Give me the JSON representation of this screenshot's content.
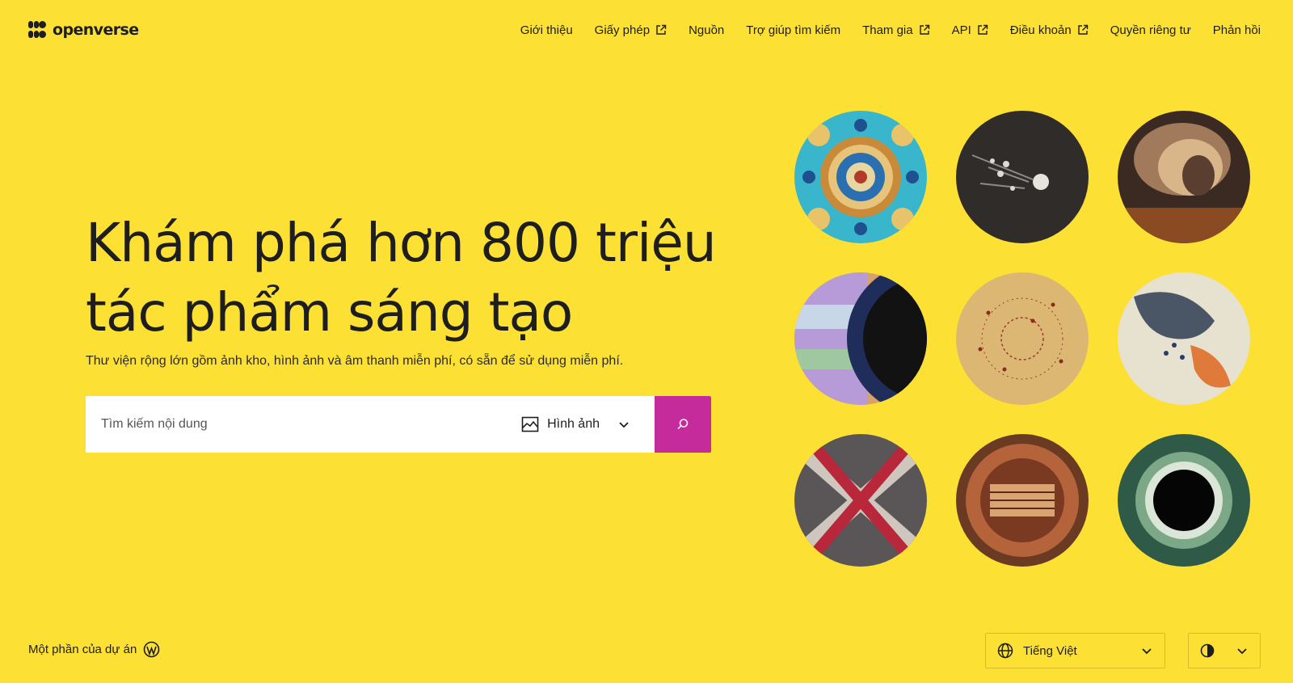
{
  "brand": {
    "name": "openverse"
  },
  "nav": {
    "items": [
      {
        "label": "Giới thiệu",
        "external": false
      },
      {
        "label": "Giấy phép",
        "external": true
      },
      {
        "label": "Nguồn",
        "external": false
      },
      {
        "label": "Trợ giúp tìm kiếm",
        "external": false
      },
      {
        "label": "Tham gia",
        "external": true
      },
      {
        "label": "API",
        "external": true
      },
      {
        "label": "Điều khoản",
        "external": true
      },
      {
        "label": "Quyền riêng tư",
        "external": false
      },
      {
        "label": "Phản hồi",
        "external": false
      }
    ]
  },
  "hero": {
    "title_line1": "Khám phá hơn 800 triệu",
    "title_line2": "tác phẩm sáng tạo",
    "subtitle": "Thư viện rộng lớn gồm ảnh kho, hình ảnh và âm thanh miễn phí, có sẵn để sử dụng miễn phí."
  },
  "search": {
    "placeholder": "Tìm kiếm nội dung",
    "value": "",
    "content_type": "Hình ảnh",
    "button_icon": "search-icon"
  },
  "gallery": {
    "images": [
      {
        "name": "tile-mandala",
        "icon": "image-thumbnail"
      },
      {
        "name": "comets",
        "icon": "image-thumbnail"
      },
      {
        "name": "nebula",
        "icon": "image-thumbnail"
      },
      {
        "name": "saturn-rings",
        "icon": "image-thumbnail"
      },
      {
        "name": "star-map",
        "icon": "image-thumbnail"
      },
      {
        "name": "taurus-constellation",
        "icon": "image-thumbnail"
      },
      {
        "name": "woven-textile",
        "icon": "image-thumbnail"
      },
      {
        "name": "ornate-disc",
        "icon": "image-thumbnail"
      },
      {
        "name": "solar-eclipse",
        "icon": "image-thumbnail"
      }
    ]
  },
  "footer": {
    "project_text": "Một phần của dự án",
    "project_icon": "wordpress-icon",
    "language": "Tiếng Việt",
    "theme_icon": "contrast-icon"
  },
  "colors": {
    "background": "#fde034",
    "accent": "#c52b9b",
    "text": "#1e1e1e"
  }
}
